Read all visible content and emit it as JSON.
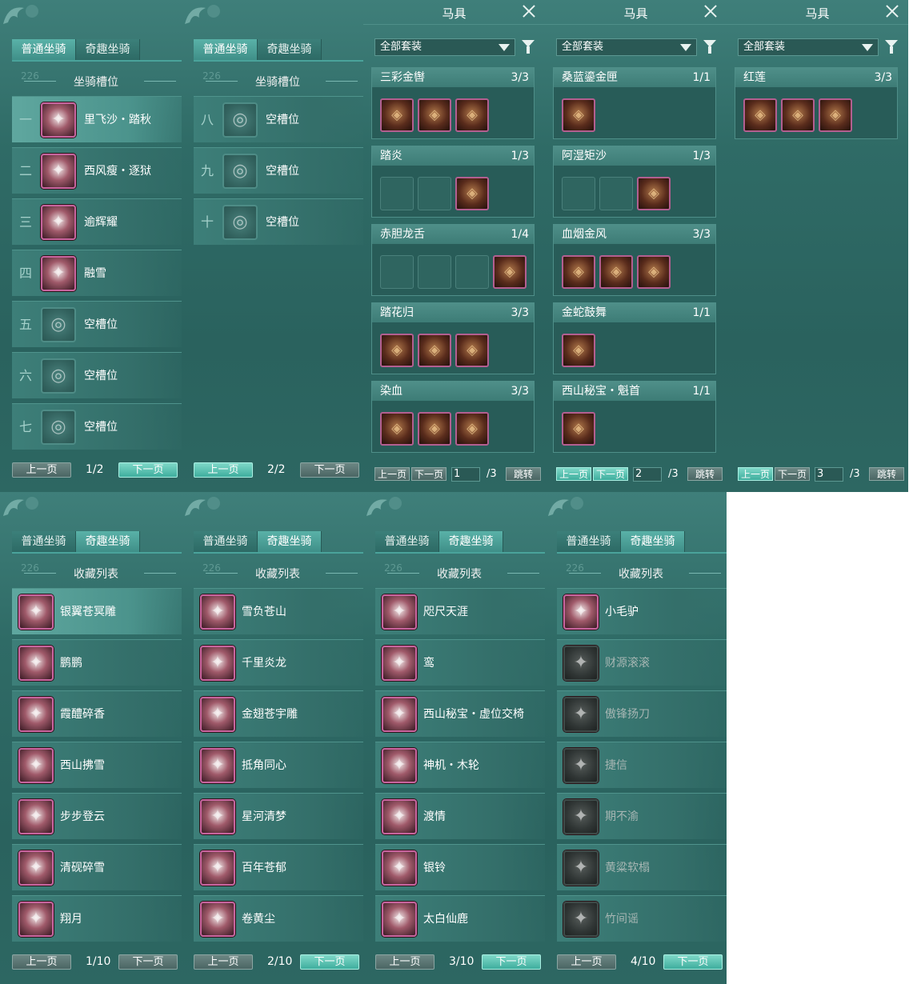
{
  "slot_panels": [
    {
      "tabs": [
        "普通坐骑",
        "奇趣坐骑"
      ],
      "active_tab": 0,
      "section": "坐骑槽位",
      "section_num": "226",
      "rows": [
        {
          "idx": "一",
          "label": "里飞沙・踏秋",
          "empty": false,
          "selected": true,
          "icon": "horse-red-icon"
        },
        {
          "idx": "二",
          "label": "西风瘦・逐狱",
          "empty": false,
          "selected": false,
          "icon": "horse-black-icon"
        },
        {
          "idx": "三",
          "label": "逾辉耀",
          "empty": false,
          "selected": false,
          "icon": "horse-white-icon"
        },
        {
          "idx": "四",
          "label": "融雪",
          "empty": false,
          "selected": false,
          "icon": "horse-red-icon"
        },
        {
          "idx": "五",
          "label": "空槽位",
          "empty": true,
          "selected": false,
          "icon": "empty-slot-icon"
        },
        {
          "idx": "六",
          "label": "空槽位",
          "empty": true,
          "selected": false,
          "icon": "empty-slot-icon"
        },
        {
          "idx": "七",
          "label": "空槽位",
          "empty": true,
          "selected": false,
          "icon": "empty-slot-icon"
        }
      ],
      "prev": "上一页",
      "page": "1/2",
      "next": "下一页",
      "prev_hl": false,
      "next_hl": true
    },
    {
      "tabs": [
        "普通坐骑",
        "奇趣坐骑"
      ],
      "active_tab": 0,
      "section": "坐骑槽位",
      "section_num": "226",
      "rows": [
        {
          "idx": "八",
          "label": "空槽位",
          "empty": true,
          "selected": false,
          "icon": "empty-slot-icon"
        },
        {
          "idx": "九",
          "label": "空槽位",
          "empty": true,
          "selected": false,
          "icon": "empty-slot-icon"
        },
        {
          "idx": "十",
          "label": "空槽位",
          "empty": true,
          "selected": false,
          "icon": "empty-slot-icon"
        }
      ],
      "prev": "上一页",
      "page": "2/2",
      "next": "下一页",
      "prev_hl": true,
      "next_hl": false
    }
  ],
  "gear_panels": [
    {
      "title": "马具",
      "filter": "全部套装",
      "sets": [
        {
          "name": "三彩金辔",
          "count": "3/3",
          "slots": [
            1,
            1,
            1
          ]
        },
        {
          "name": "踏炎",
          "count": "1/3",
          "slots": [
            0,
            0,
            1
          ]
        },
        {
          "name": "赤胆龙舌",
          "count": "1/4",
          "slots": [
            0,
            0,
            0,
            1
          ]
        },
        {
          "name": "踏花归",
          "count": "3/3",
          "slots": [
            1,
            1,
            1
          ]
        },
        {
          "name": "染血",
          "count": "3/3",
          "slots": [
            1,
            1,
            1
          ]
        }
      ],
      "prev": "上一页",
      "next": "下一页",
      "page_input": "1",
      "total": "/3",
      "jump": "跳转",
      "prev_hl": false,
      "next_hl": false
    },
    {
      "title": "马具",
      "filter": "全部套装",
      "sets": [
        {
          "name": "桑蓝鎏金匣",
          "count": "1/1",
          "slots": [
            1
          ]
        },
        {
          "name": "阿湿矩沙",
          "count": "1/3",
          "slots": [
            0,
            0,
            1
          ]
        },
        {
          "name": "血烟金风",
          "count": "3/3",
          "slots": [
            1,
            1,
            1
          ]
        },
        {
          "name": "金蛇鼓舞",
          "count": "1/1",
          "slots": [
            1
          ]
        },
        {
          "name": "西山秘宝・魁首",
          "count": "1/1",
          "slots": [
            1
          ]
        }
      ],
      "prev": "上一页",
      "next": "下一页",
      "page_input": "2",
      "total": "/3",
      "jump": "跳转",
      "prev_hl": true,
      "next_hl": true
    },
    {
      "title": "马具",
      "filter": "全部套装",
      "sets": [
        {
          "name": "红莲",
          "count": "3/3",
          "slots": [
            1,
            1,
            1
          ]
        }
      ],
      "prev": "上一页",
      "next": "下一页",
      "page_input": "3",
      "total": "/3",
      "jump": "跳转",
      "prev_hl": true,
      "next_hl": false
    }
  ],
  "collection_panels": [
    {
      "tabs": [
        "普通坐骑",
        "奇趣坐骑"
      ],
      "active_tab": 1,
      "section": "收藏列表",
      "section_num": "226",
      "rows": [
        {
          "label": "银翼苍冥雕",
          "dim": false,
          "selected": true,
          "icon": "eagle-icon"
        },
        {
          "label": "鹏鹏",
          "dim": false,
          "selected": false,
          "icon": "sheep-icon"
        },
        {
          "label": "霞醴碎香",
          "dim": false,
          "selected": false,
          "icon": "horse-white-icon"
        },
        {
          "label": "西山拂雪",
          "dim": false,
          "selected": false,
          "icon": "deer-icon"
        },
        {
          "label": "步步登云",
          "dim": false,
          "selected": false,
          "icon": "stilts-icon"
        },
        {
          "label": "清砚碎雪",
          "dim": false,
          "selected": false,
          "icon": "horse-white-icon"
        },
        {
          "label": "翔月",
          "dim": false,
          "selected": false,
          "icon": "horse-white-icon"
        }
      ],
      "prev": "上一页",
      "page": "1/10",
      "next": "下一页",
      "prev_hl": false,
      "next_hl": false
    },
    {
      "tabs": [
        "普通坐骑",
        "奇趣坐骑"
      ],
      "active_tab": 1,
      "section": "收藏列表",
      "section_num": "226",
      "rows": [
        {
          "label": "雪负苍山",
          "dim": false,
          "selected": false,
          "icon": "goat-icon"
        },
        {
          "label": "千里炎龙",
          "dim": false,
          "selected": false,
          "icon": "dragon-icon"
        },
        {
          "label": "金翅苍宇雕",
          "dim": false,
          "selected": false,
          "icon": "eagle-icon"
        },
        {
          "label": "抵角同心",
          "dim": false,
          "selected": false,
          "icon": "bull-icon"
        },
        {
          "label": "星河清梦",
          "dim": false,
          "selected": false,
          "icon": "boat-icon"
        },
        {
          "label": "百年苍郁",
          "dim": false,
          "selected": false,
          "icon": "tree-icon"
        },
        {
          "label": "卷黄尘",
          "dim": false,
          "selected": false,
          "icon": "horse-red-icon"
        }
      ],
      "prev": "上一页",
      "page": "2/10",
      "next": "下一页",
      "prev_hl": false,
      "next_hl": true
    },
    {
      "tabs": [
        "普通坐骑",
        "奇趣坐骑"
      ],
      "active_tab": 1,
      "section": "收藏列表",
      "section_num": "226",
      "rows": [
        {
          "label": "咫尺天涯",
          "dim": false,
          "selected": false,
          "icon": "mech-icon"
        },
        {
          "label": "鸾",
          "dim": false,
          "selected": false,
          "icon": "bird-icon"
        },
        {
          "label": "西山秘宝・虚位交椅",
          "dim": false,
          "selected": false,
          "icon": "chair-icon"
        },
        {
          "label": "神机・木轮",
          "dim": false,
          "selected": false,
          "icon": "wheel-icon"
        },
        {
          "label": "渡情",
          "dim": false,
          "selected": false,
          "icon": "raft-icon"
        },
        {
          "label": "银铃",
          "dim": false,
          "selected": false,
          "icon": "bell-icon"
        },
        {
          "label": "太白仙鹿",
          "dim": false,
          "selected": false,
          "icon": "antler-icon"
        }
      ],
      "prev": "上一页",
      "page": "3/10",
      "next": "下一页",
      "prev_hl": false,
      "next_hl": true
    },
    {
      "tabs": [
        "普通坐骑",
        "奇趣坐骑"
      ],
      "active_tab": 1,
      "section": "收藏列表",
      "section_num": "226",
      "rows": [
        {
          "label": "小毛驴",
          "dim": false,
          "selected": false,
          "icon": "donkey-icon"
        },
        {
          "label": "财源滚滚",
          "dim": true,
          "selected": false,
          "icon": "cart-icon"
        },
        {
          "label": "傲锋扬刀",
          "dim": true,
          "selected": false,
          "icon": "beast-icon"
        },
        {
          "label": "捷信",
          "dim": true,
          "selected": false,
          "icon": "elephant-icon"
        },
        {
          "label": "期不渝",
          "dim": true,
          "selected": false,
          "icon": "ape-icon"
        },
        {
          "label": "黄粱软榻",
          "dim": true,
          "selected": false,
          "icon": "couch-icon"
        },
        {
          "label": "竹间谣",
          "dim": true,
          "selected": false,
          "icon": "panda-icon"
        }
      ],
      "prev": "上一页",
      "page": "4/10",
      "next": "下一页",
      "prev_hl": false,
      "next_hl": true
    }
  ]
}
